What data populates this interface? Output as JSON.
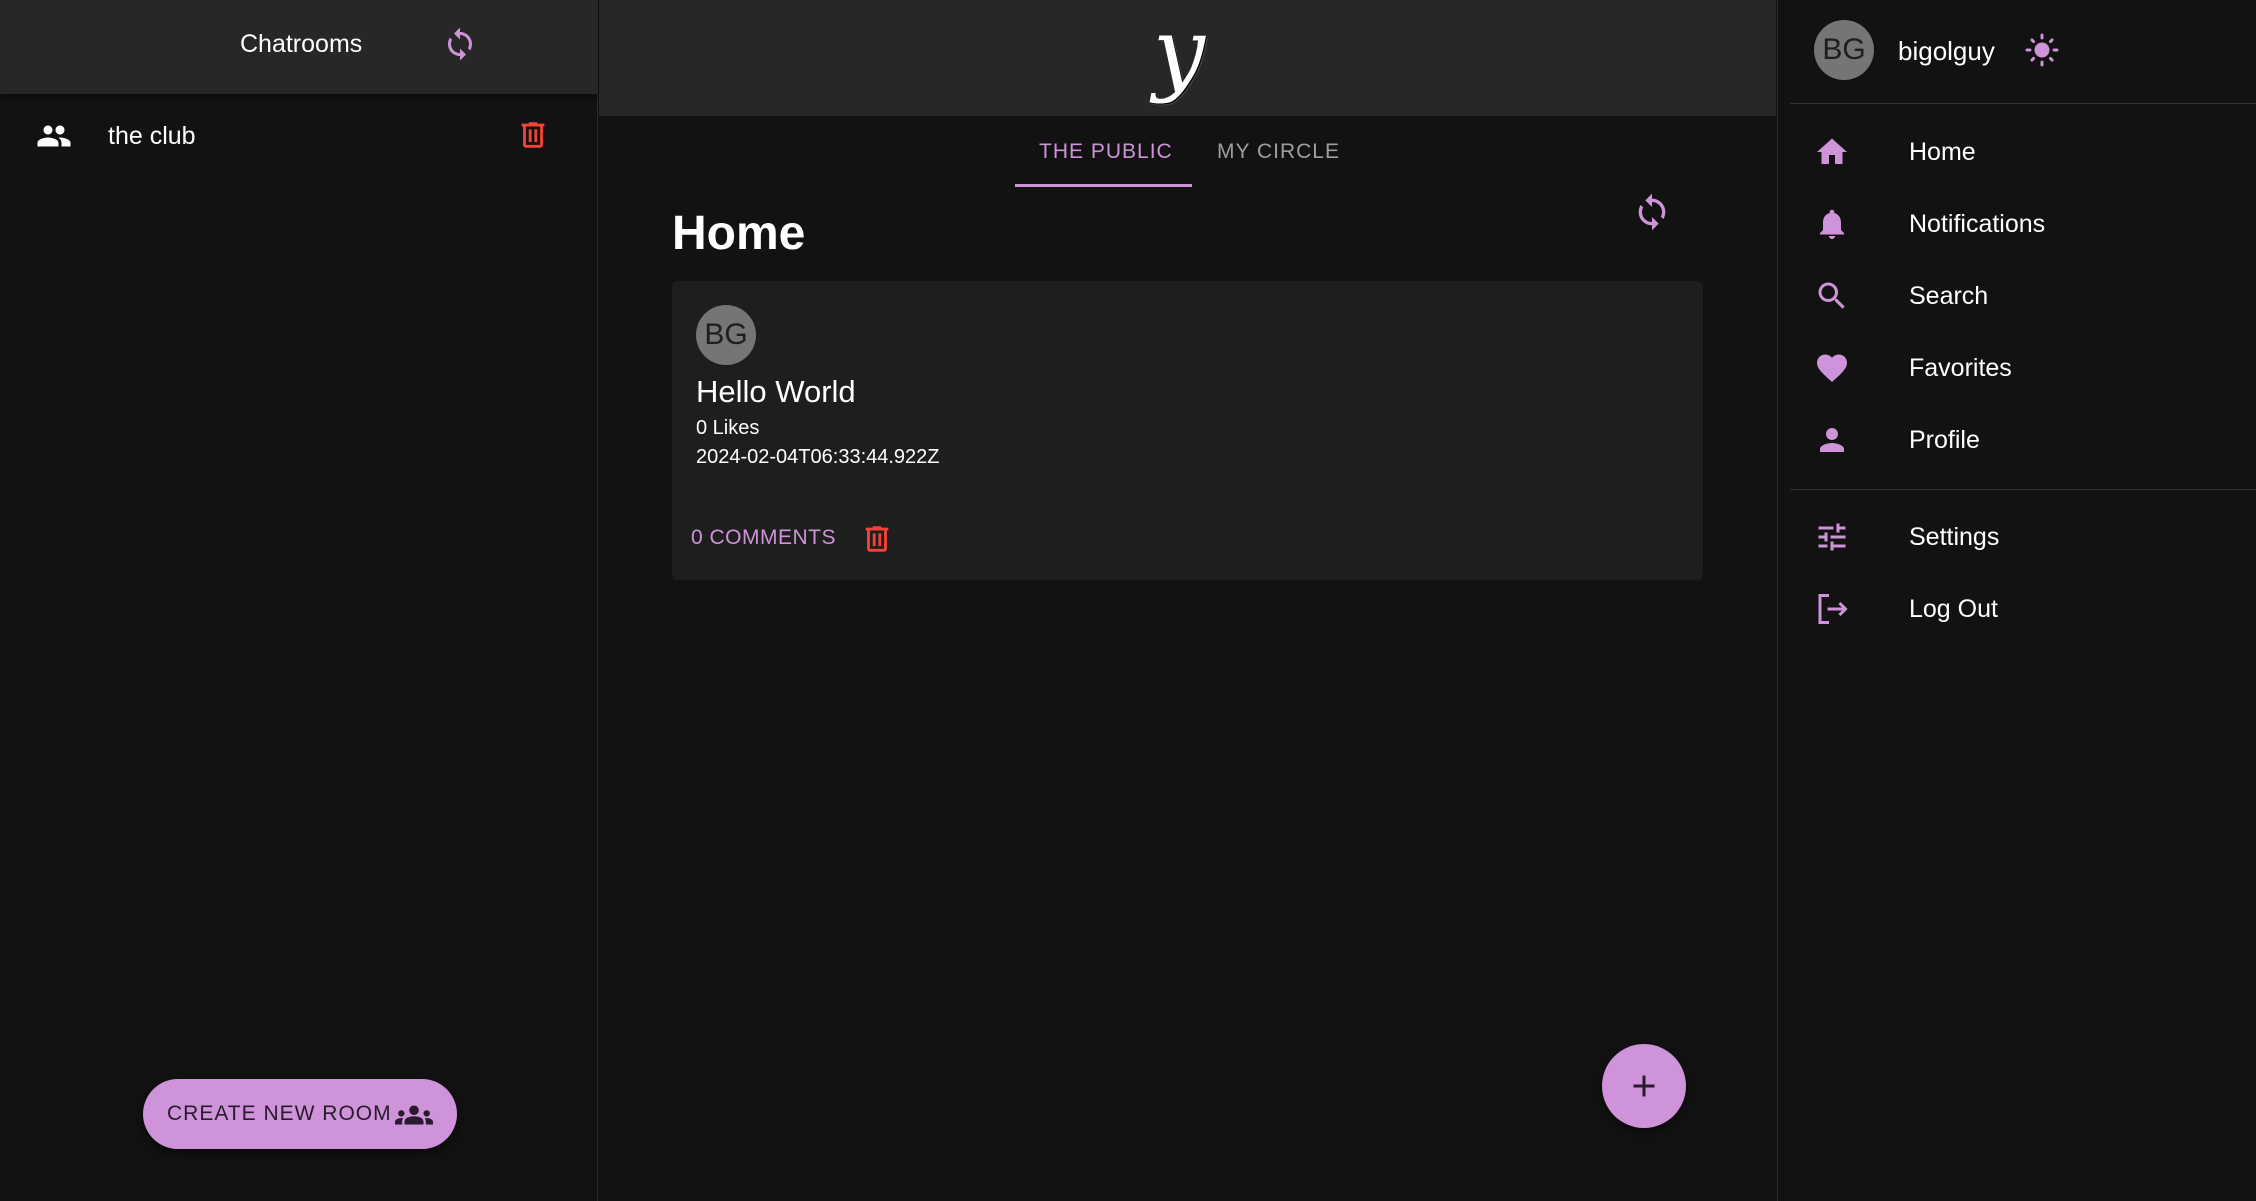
{
  "left_sidebar": {
    "title": "Chatrooms",
    "rooms": [
      {
        "label": "the club"
      }
    ],
    "create_room_label": "CREATE NEW ROOM"
  },
  "header": {
    "logo": "y"
  },
  "tabs": [
    {
      "label": "THE PUBLIC",
      "active": true
    },
    {
      "label": "MY CIRCLE",
      "active": false
    }
  ],
  "main": {
    "page_title": "Home",
    "posts": [
      {
        "avatar_initials": "BG",
        "title": "Hello World",
        "likes": "0 Likes",
        "timestamp": "2024-02-04T06:33:44.922Z",
        "comments_label": "0 COMMENTS"
      }
    ]
  },
  "right_sidebar": {
    "user": {
      "avatar_initials": "BG",
      "username": "bigolguy"
    },
    "nav": [
      {
        "label": "Home",
        "icon": "home-icon"
      },
      {
        "label": "Notifications",
        "icon": "bell-icon"
      },
      {
        "label": "Search",
        "icon": "search-icon"
      },
      {
        "label": "Favorites",
        "icon": "heart-icon"
      },
      {
        "label": "Profile",
        "icon": "person-icon"
      }
    ],
    "nav_secondary": [
      {
        "label": "Settings",
        "icon": "sliders-icon"
      },
      {
        "label": "Log Out",
        "icon": "logout-icon"
      }
    ]
  },
  "colors": {
    "accent": "#ce93d8",
    "danger": "#f44336",
    "background": "#121212",
    "surface": "#1e1e1e",
    "header": "#272727"
  }
}
